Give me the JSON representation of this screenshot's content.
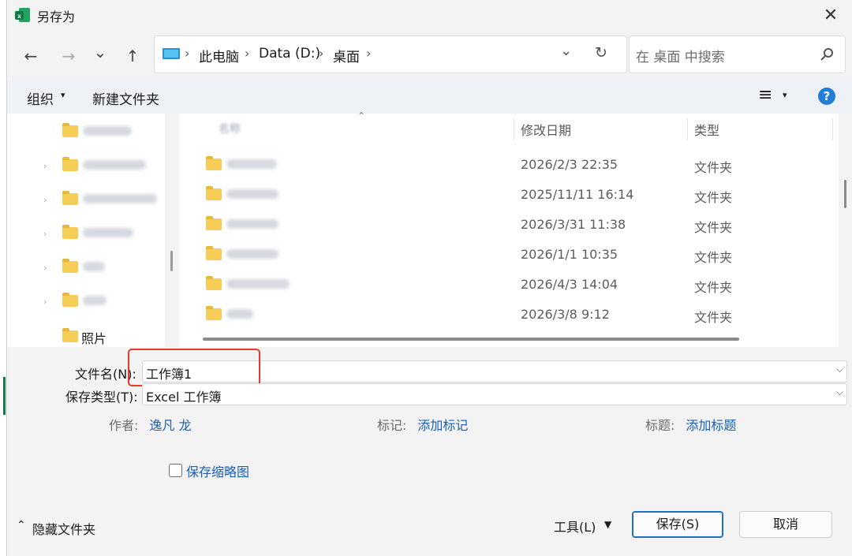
{
  "window": {
    "title": "另存为",
    "close_glyph": "✕"
  },
  "nav": {
    "back": "←",
    "forward": "→",
    "recent": "⌄",
    "up": "↑",
    "refresh": "↻"
  },
  "address": {
    "crumbs": [
      "此电脑",
      "Data (D:)",
      "桌面"
    ],
    "sep": "›"
  },
  "search": {
    "placeholder": "在 桌面 中搜索"
  },
  "toolbar": {
    "organize": "组织",
    "organize_arrow": "▾",
    "new_folder": "新建文件夹",
    "view_glyph": "≡",
    "view_arrow": "▾",
    "help": "?"
  },
  "sidebar": {
    "items": [
      {
        "label": "照片"
      }
    ]
  },
  "columns": {
    "name": "名称",
    "modified": "修改日期",
    "type": "类型"
  },
  "files": [
    {
      "modified": "2026/2/3 22:35",
      "type": "文件夹"
    },
    {
      "modified": "2025/11/11 16:14",
      "type": "文件夹"
    },
    {
      "modified": "2026/3/31 11:38",
      "type": "文件夹"
    },
    {
      "modified": "2026/1/1 10:35",
      "type": "文件夹"
    },
    {
      "modified": "2026/4/3 14:04",
      "type": "文件夹"
    },
    {
      "modified": "2026/3/8 9:12",
      "type": "文件夹"
    }
  ],
  "form": {
    "filename_label": "文件名(N):",
    "filename_value": "工作簿1",
    "filetype_label": "保存类型(T):",
    "filetype_value": "Excel 工作簿",
    "dropdown_glyph": "⌵"
  },
  "meta": {
    "author_label": "作者:",
    "author_value": "逸凡 龙",
    "tags_label": "标记:",
    "tags_value": "添加标记",
    "title_label": "标题:",
    "title_value": "添加标题"
  },
  "thumbnail": {
    "label": "保存缩略图",
    "checked": false
  },
  "footer": {
    "hide_folders": "隐藏文件夹",
    "hide_glyph": "⌃",
    "tools": "工具(L)",
    "tools_arrow": "▼",
    "save": "保存(S)",
    "cancel": "取消"
  },
  "colors": {
    "accent": "#1d6fbf",
    "link": "#1a5fb4",
    "folder": "#f6cd57",
    "highlight": "#e53a32",
    "help": "#1f7fd6"
  }
}
